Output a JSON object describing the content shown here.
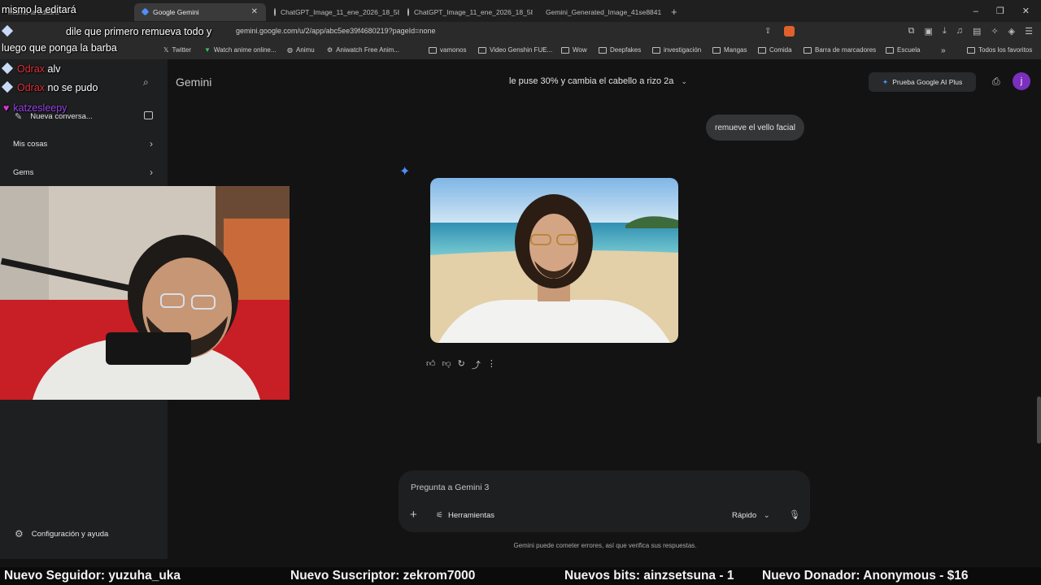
{
  "browser": {
    "tabs": [
      {
        "label": "mismo la editará",
        "active": false
      },
      {
        "label": "Google Gemini",
        "active": true
      },
      {
        "label": "ChatGPT_Image_11_ene_2026_18_58",
        "active": false
      },
      {
        "label": "ChatGPT_Image_11_ene_2026_18_58",
        "active": false
      },
      {
        "label": "Gemini_Generated_Image_41se8841",
        "active": false
      }
    ],
    "url": "gemini.google.com/u/2/app/abc5ee39f4680219?pageId=none",
    "bookmarks": [
      "Twitter",
      "Watch anime online...",
      "Animu",
      "Aniwatch Free Anim...",
      "vamonos",
      "Video Genshin FUE...",
      "Wow",
      "Deepfakes",
      "investigación",
      "Mangas",
      "Comida",
      "Barra de marcadores",
      "Escuela",
      "Todos los favoritos"
    ]
  },
  "sidebar": {
    "new_chat": "Nueva conversa...",
    "my_stuff": "Mis cosas",
    "gems": "Gems",
    "settings": "Configuración y ayuda"
  },
  "header": {
    "brand": "Gemini",
    "conversation_title": "le puse 30% y cambia el cabello a rizo 2a",
    "pro_button": "Prueba Google AI Plus",
    "avatar_letter": "j"
  },
  "conversation": {
    "user_message": "remueve el vello facial"
  },
  "composer": {
    "placeholder": "Pregunta a Gemini 3",
    "tools_label": "Herramientas",
    "mode_label": "Rápido",
    "disclaimer": "Gemini puede cometer errores, así que verifica sus respuestas."
  },
  "chat_overlay": [
    {
      "nick": "",
      "text": "mismo la editará"
    },
    {
      "nick": "",
      "text": "dile que primero remueva todo y"
    },
    {
      "nick": "",
      "text": "luego que ponga la barba"
    },
    {
      "nick": "Odrax",
      "text": "alv"
    },
    {
      "nick": "Odrax",
      "text": "no se pudo"
    },
    {
      "nick": "katzesleepy",
      "text": ""
    }
  ],
  "ticker": {
    "follower": "Nuevo Seguidor: yuzuha_uka",
    "subscriber": "Nuevo Suscriptor: zekrom7000",
    "bits": "Nuevos bits: ainzsetsuna - 1",
    "donor": "Nuevo Donador: Anonymous - $16"
  },
  "colors": {
    "accent": "#4f8ff7",
    "avatar": "#7b2fbe",
    "nick_red": "#e0303a",
    "nick_purple": "#9a42e8"
  }
}
